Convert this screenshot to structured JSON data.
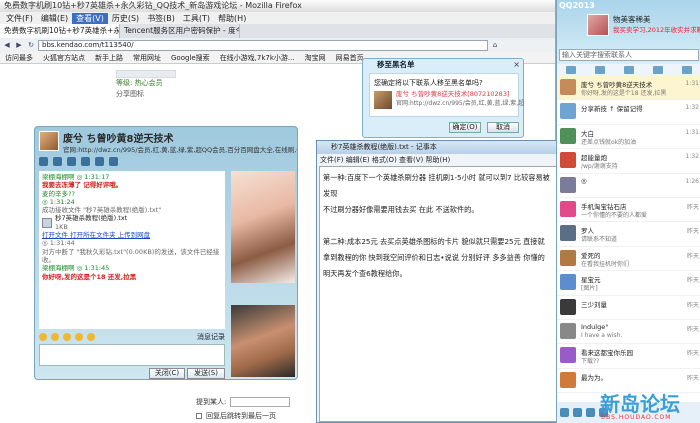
{
  "firefox": {
    "title": "免费数字机刷10钻+秒7英雄杀+永久彩钻_QQ技术_新岛游戏论坛 - Mozilla Firefox",
    "menu": [
      "文件(F)",
      "编辑(E)",
      "查看(V)",
      "历史(S)",
      "书签(B)",
      "工具(T)",
      "帮助(H)"
    ],
    "tabs": [
      "免费数字机刷10钻+秒7英雄杀+永久彩...",
      "Tencent服务区用户密码保护 - 度今 ..."
    ],
    "url": "bbs.kendao.com/t113540/",
    "bookmarks": [
      "访问最多",
      "火狐官方站点",
      "新手上路",
      "常用网址",
      "Google搜索",
      "在线小游戏,7k7k小游...",
      "淘宝网",
      "网易首页"
    ]
  },
  "forum": {
    "level_label": "等级: 热心会员",
    "row2": "分享图标",
    "reply_label": "提到某人:",
    "checkbox_label": "回复后跳转到最后一页",
    "pages": [
      "1",
      "2",
      "3"
    ]
  },
  "add_friend_dialog": {
    "title": "移至黑名单",
    "close": "×",
    "question": "您确定将以下联系人移至黑名单吗?",
    "contact_name": "废兮 ち曾吵黄8逆天技术[807210283]",
    "contact_url": "官网:http://dwz.cn/995/会员,红,黄,蓝,绿,紫,超",
    "ok": "确定(O)",
    "cancel": "取消"
  },
  "chat": {
    "name": "废兮 ち曾吵黄8逆天技术",
    "signature": "官网:http://dwz.cn/995/会员,红,黄,蓝,绿,紫,超QQ会员,百分百网盘大全,在线刷,你会了吗,宽技术",
    "messages": [
      {
        "cls": "m-green",
        "text": "梁棚海棚啊  ◎ 1:31:17"
      },
      {
        "cls": "m-red",
        "text": "我要去冻薄了 记得好评哦。"
      },
      {
        "cls": "m-green",
        "text": "麦的辛多??"
      },
      {
        "cls": "m-green",
        "text": "◎ 1:31:24"
      },
      {
        "cls": "m-gray",
        "text": "成功接收文件 \"秒7英雄杀教程(绝版).txt\""
      },
      {
        "cls": "",
        "text": "秒7英雄杀教程(绝版).txt"
      },
      {
        "cls": "m-gray",
        "text": "1KB"
      },
      {
        "cls": "m-blue",
        "text": "打开文件    打开所在文件夹    上传到网盘"
      },
      {
        "cls": "m-gray",
        "text": "◎ 1:31:44"
      },
      {
        "cls": "m-gray",
        "text": "对方中断了 \"我秋久彩钻.txt\"(0.00KB)的发送，该文件已经接收。"
      },
      {
        "cls": "m-green",
        "text": "梁棚海棚啊  ◎ 1:31:45"
      },
      {
        "cls": "m-red",
        "text": "你好呀,发的这是个18 还发,拉黑"
      }
    ],
    "toolbar_right": "消息记录",
    "close_btn": "关闭(C)",
    "send_btn": "发送(S)"
  },
  "notepad": {
    "title": "秒7英雄杀教程(绝版).txt - 记事本",
    "menu": "文件(F)  编辑(E)  格式(O)  查看(V)  帮助(H)",
    "text": "第一种:百度下一个英雄杀刷分器 挂机刷1-5小时 就可以到7 比较容易被发现\n不过刷分器好像需要用钱去买 在此 不送软件的。\n\n第二种:成本25元 去买点英雄杀图标的卡片 貌似就只需要25元 直接就\n拿到教程的你 快到我空间评价和日志•说说 分别好评 多多益善 你懂的\n明天再发个查6教程给你。"
  },
  "qq": {
    "brand": "QQ2013",
    "user_name": "物美客稀美",
    "user_signature": "我买卖学习,2012年收实并求鞭党...",
    "search_placeholder": "输入关键字搜索联系人",
    "contacts": [
      {
        "name": "废兮 ち曾吵黄8逆天技术",
        "sig": "你好呀,发的这是个18 还发,拉黑",
        "time": "1:31",
        "color": "#c78a5a",
        "hl": true
      },
      {
        "name": "分享新技 ↑ 保留记得",
        "sig": "",
        "time": "1:32",
        "color": "#6fa3d1",
        "hl": false
      },
      {
        "name": "大白",
        "sig": "还差点钱就ok的加油",
        "time": "1:31",
        "color": "#4f8f5a",
        "hl": false
      },
      {
        "name": "超能量炮",
        "sig": "/wp/谢谢支持",
        "time": "1:32",
        "color": "#d24a3a",
        "hl": false
      },
      {
        "name": "◎",
        "sig": "",
        "time": "1:26",
        "color": "#7b7b9c",
        "hl": false
      },
      {
        "name": "手机淘宝钻石店",
        "sig": "一个你懂的不要的人都爱",
        "time": "昨天",
        "color": "#e04a8a",
        "hl": false
      },
      {
        "name": "罗人",
        "sig": "请联系不知道",
        "time": "昨天",
        "color": "#5a6e88",
        "hl": false
      },
      {
        "name": "爱死的",
        "sig": "在看我挂机时你们",
        "time": "昨天",
        "color": "#b07a40",
        "hl": false
      },
      {
        "name": "星宝元",
        "sig": "[图片]",
        "time": "昨天",
        "color": "#5a8ed0",
        "hl": false
      },
      {
        "name": "三少刘量",
        "sig": "",
        "time": "昨天",
        "color": "#3a3a3a",
        "hl": false
      },
      {
        "name": "Indulge°",
        "sig": "I have a wish.",
        "time": "昨天",
        "color": "#888888",
        "hl": false
      },
      {
        "name": "看来这都宝你乐园",
        "sig": "下载??",
        "time": "昨天",
        "color": "#9a5ac8",
        "hl": false
      },
      {
        "name": "最为为。",
        "sig": "",
        "time": "昨天",
        "color": "#d07a3a",
        "hl": false
      }
    ]
  },
  "watermark": "新岛论坛",
  "watermark_sub": "BBS.HOUDAO.COM"
}
